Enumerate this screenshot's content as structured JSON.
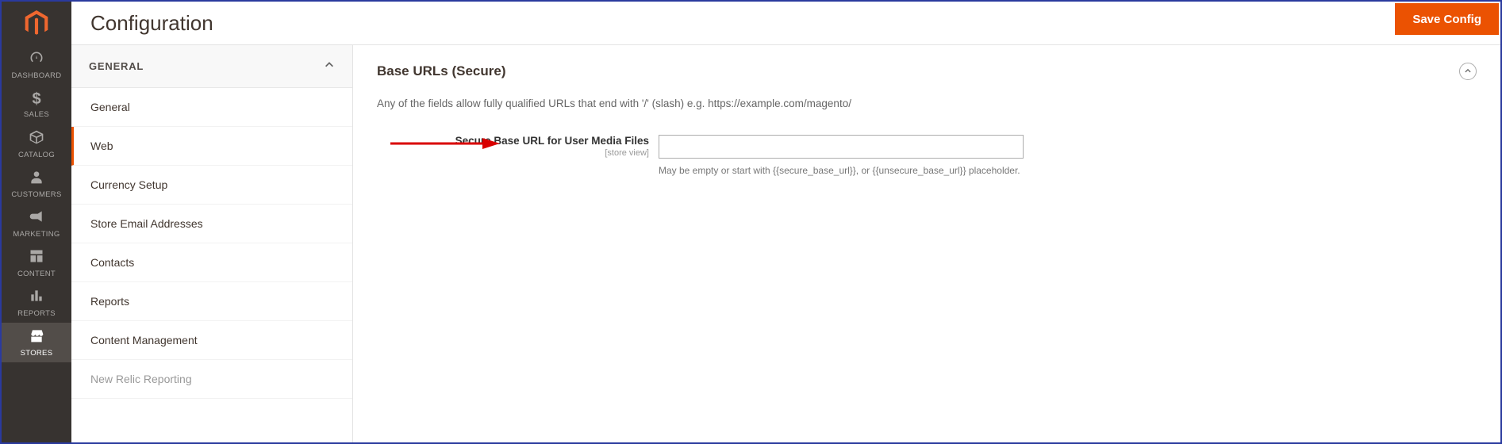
{
  "page_title": "Configuration",
  "save_button": "Save Config",
  "leftnav": {
    "items": [
      {
        "label": "DASHBOARD"
      },
      {
        "label": "SALES"
      },
      {
        "label": "CATALOG"
      },
      {
        "label": "CUSTOMERS"
      },
      {
        "label": "MARKETING"
      },
      {
        "label": "CONTENT"
      },
      {
        "label": "REPORTS"
      },
      {
        "label": "STORES"
      }
    ]
  },
  "config_sidebar": {
    "section_head": "GENERAL",
    "items": [
      "General",
      "Web",
      "Currency Setup",
      "Store Email Addresses",
      "Contacts",
      "Reports",
      "Content Management",
      "New Relic Reporting"
    ],
    "active_index": 1
  },
  "section": {
    "title": "Base URLs (Secure)",
    "description": "Any of the fields allow fully qualified URLs that end with '/' (slash) e.g. https://example.com/magento/",
    "field": {
      "label": "Secure Base URL for User Media Files",
      "scope": "[store view]",
      "value": "",
      "help": "May be empty or start with {{secure_base_url}}, or {{unsecure_base_url}} placeholder."
    }
  }
}
